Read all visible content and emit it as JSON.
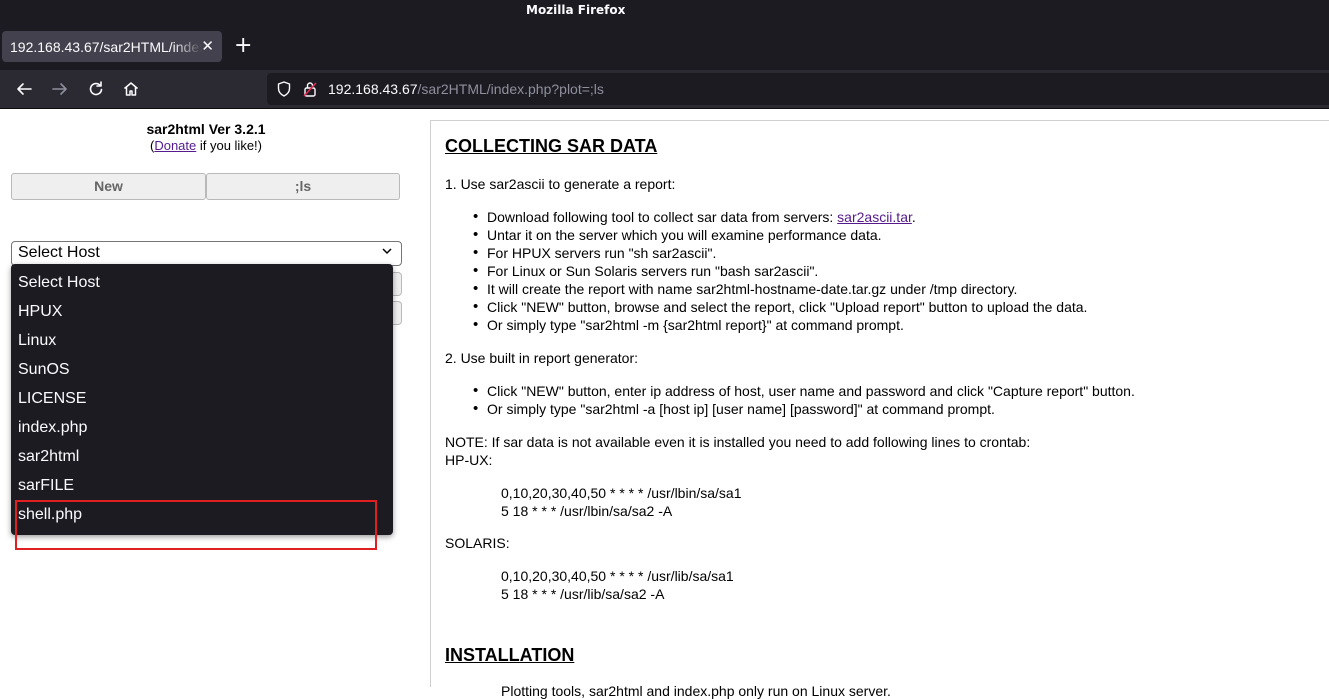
{
  "browser": {
    "window_title": "Mozilla Firefox",
    "tab_title": "192.168.43.67/sar2HTML/index.php?plot=;ls",
    "tab_close": "✕",
    "new_tab": "+",
    "url_host": "192.168.43.67",
    "url_path": "/sar2HTML/index.php?plot=;ls",
    "icons": [
      "back-arrow-icon",
      "forward-arrow-icon",
      "reload-icon",
      "home-icon",
      "shield-icon",
      "lock-icon"
    ]
  },
  "left": {
    "title": "sar2html Ver 3.2.1",
    "donate_prefix": "(",
    "donate_link": "Donate",
    "donate_suffix": " if you like!)",
    "buttons": {
      "new_label": "New",
      "plot_label": ";ls"
    },
    "host_select": {
      "selected": "Select Host",
      "options": [
        "Select Host",
        "HPUX",
        "Linux",
        "SunOS",
        "LICENSE",
        "index.php",
        "sar2html",
        "sarFILE",
        "shell.php"
      ]
    },
    "highlight_color": "#e02020"
  },
  "main": {
    "section1_heading": "COLLECTING SAR DATA",
    "step1": "1. Use sar2ascii to generate a report:",
    "step1_bullets": {
      "b1_prefix": "Download following tool to collect sar data from servers: ",
      "b1_link": "sar2ascii.tar",
      "b1_suffix": ".",
      "b2": "Untar it on the server which you will examine performance data.",
      "b3": "For HPUX servers run \"sh sar2ascii\".",
      "b4": "For Linux or Sun Solaris servers run \"bash sar2ascii\".",
      "b5": "It will create the report with name sar2html-hostname-date.tar.gz under /tmp directory.",
      "b6": "Click \"NEW\" button, browse and select the report, click \"Upload report\" button to upload the data.",
      "b7": "Or simply type \"sar2html -m {sar2html report}\" at command prompt."
    },
    "step2": "2. Use built in report generator:",
    "step2_bullets": {
      "b1": "Click \"NEW\" button, enter ip address of host, user name and password and click \"Capture report\" button.",
      "b2": "Or simply type \"sar2html -a [host ip] [user name] [password]\" at command prompt."
    },
    "note": "NOTE: If sar data is not available even it is installed you need to add following lines to crontab:",
    "hpux_label": "HP-UX:",
    "hpux_lines": [
      "0,10,20,30,40,50 * * * * /usr/lbin/sa/sa1",
      "5 18 * * * /usr/lbin/sa/sa2 -A"
    ],
    "solaris_label": "SOLARIS:",
    "solaris_lines": [
      "0,10,20,30,40,50 * * * * /usr/lib/sa/sa1",
      "5 18 * * * /usr/lib/sa/sa2 -A"
    ],
    "section2_heading": "INSTALLATION",
    "install_partial": "Plotting tools, sar2html and index.php only run on Linux server."
  }
}
